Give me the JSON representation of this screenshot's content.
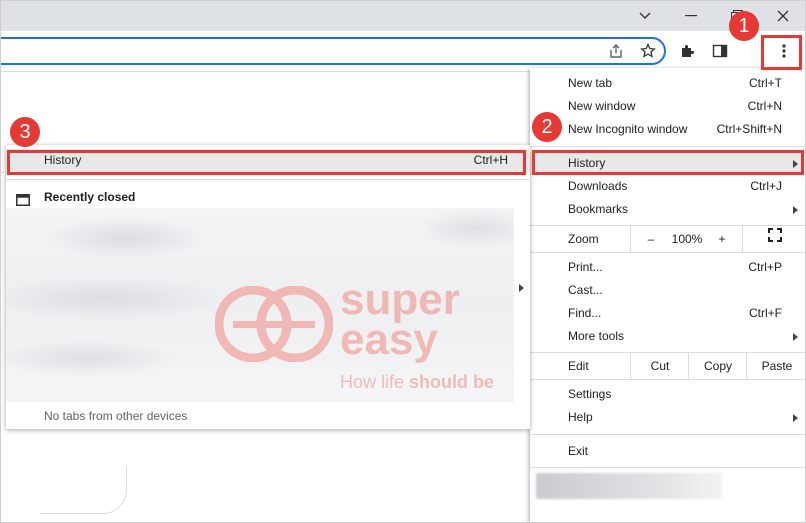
{
  "menu": {
    "items_top": [
      {
        "label": "New tab",
        "shortcut": "Ctrl+T"
      },
      {
        "label": "New window",
        "shortcut": "Ctrl+N"
      },
      {
        "label": "New Incognito window",
        "shortcut": "Ctrl+Shift+N"
      }
    ],
    "history": {
      "label": "History"
    },
    "downloads": {
      "label": "Downloads",
      "shortcut": "Ctrl+J"
    },
    "bookmarks": {
      "label": "Bookmarks"
    },
    "zoom": {
      "label": "Zoom",
      "minus": "–",
      "value": "100%",
      "plus": "+"
    },
    "print": {
      "label": "Print...",
      "shortcut": "Ctrl+P"
    },
    "cast": {
      "label": "Cast..."
    },
    "find": {
      "label": "Find...",
      "shortcut": "Ctrl+F"
    },
    "more_tools": {
      "label": "More tools"
    },
    "edit": {
      "label": "Edit",
      "cut": "Cut",
      "copy": "Copy",
      "paste": "Paste"
    },
    "settings": {
      "label": "Settings"
    },
    "help": {
      "label": "Help"
    },
    "exit": {
      "label": "Exit"
    }
  },
  "history_submenu": {
    "history_label": "History",
    "history_shortcut": "Ctrl+H",
    "recently_closed": "Recently closed",
    "no_tabs": "No tabs from other devices"
  },
  "annotations": {
    "badge1": "1",
    "badge2": "2",
    "badge3": "3",
    "color": "#e53935"
  },
  "watermark": {
    "line1": "super",
    "line2": "easy",
    "tagline_a": "How life ",
    "tagline_b": "should be"
  },
  "icons": [
    "minimize-icon",
    "chevron-down-icon",
    "restore-icon",
    "close-icon",
    "share-icon",
    "star-icon",
    "extensions-icon",
    "side-panel-icon",
    "kebab-menu-icon",
    "fullscreen-icon",
    "tab-icon"
  ]
}
